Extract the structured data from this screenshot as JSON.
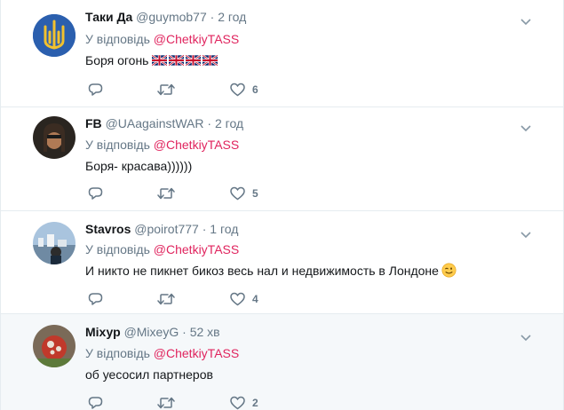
{
  "colors": {
    "mention": "#e0245e",
    "meta": "#657786",
    "text": "#14171a",
    "divider": "#e6ecf0",
    "highlight_bg": "#f5f8fa"
  },
  "tweets": [
    {
      "name": "Таки Да",
      "handle": "@guymob77",
      "sep": "·",
      "time": "2 год",
      "reply_prefix": "У відповідь",
      "mention": "@ChetkiyTASS",
      "text": "Боря огонь",
      "text_emoji": [
        "uk-flag-emoji",
        "uk-flag-emoji",
        "uk-flag-emoji",
        "uk-flag-emoji"
      ],
      "likes": "6"
    },
    {
      "name": "FB",
      "handle": "@UAagainstWAR",
      "sep": "·",
      "time": "2 год",
      "reply_prefix": "У відповідь",
      "mention": "@ChetkiyTASS",
      "text": "Боря- красава))))))",
      "likes": "5"
    },
    {
      "name": "Stavros",
      "handle": "@poirot777",
      "sep": "·",
      "time": "1 год",
      "reply_prefix": "У відповідь",
      "mention": "@ChetkiyTASS",
      "text": "И никто не пикнет бикоз весь нал и недвижимость в  Лондоне",
      "text_emoji": [
        "winking-face-emoji"
      ],
      "likes": "4"
    },
    {
      "name": "Міхур",
      "handle": "@MixeyG",
      "sep": "·",
      "time": "52 хв",
      "reply_prefix": "У відповідь",
      "mention": "@ChetkiyTASS",
      "text": "об  уесосил партнеров",
      "likes": "2"
    }
  ]
}
